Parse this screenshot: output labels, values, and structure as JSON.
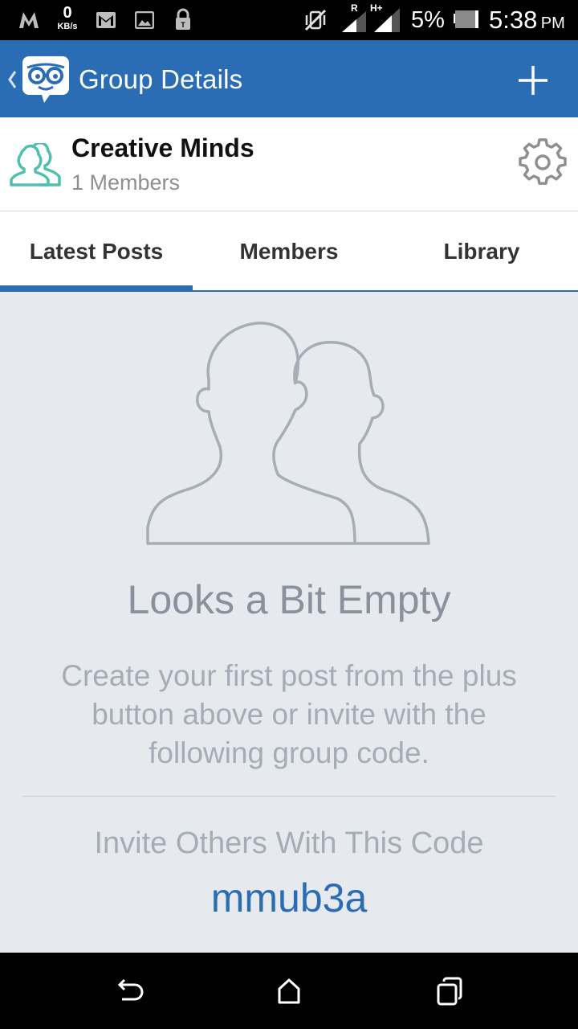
{
  "status_bar": {
    "kbs_value": "0",
    "kbs_unit": "KB/s",
    "battery": "5%",
    "time": "5:38",
    "ampm": "PM",
    "signal_r": "R",
    "signal_h": "H+"
  },
  "app_bar": {
    "title": "Group Details"
  },
  "group": {
    "name": "Creative Minds",
    "members": "1 Members"
  },
  "tabs": [
    {
      "label": "Latest Posts"
    },
    {
      "label": "Members"
    },
    {
      "label": "Library"
    }
  ],
  "empty_state": {
    "title": "Looks a Bit Empty",
    "description": "Create your first post from the plus button above or invite with the following group code.",
    "invite_label": "Invite Others With This Code",
    "invite_code": "mmub3a"
  },
  "colors": {
    "brand_blue": "#2a6db5",
    "group_icon_teal": "#4fbfae",
    "background": "#e6eaef"
  }
}
